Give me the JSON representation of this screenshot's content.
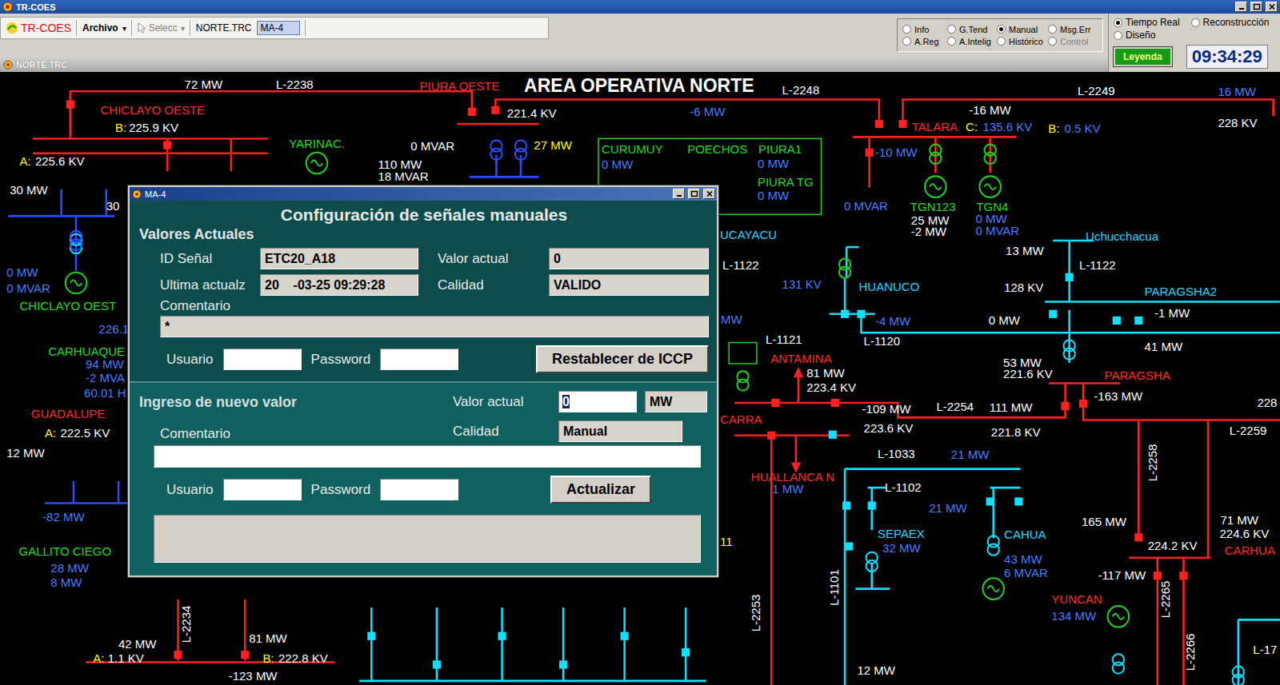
{
  "window": {
    "title": "TR-COES"
  },
  "toolbar": {
    "logo": "TR-COES",
    "menu": "Archivo",
    "menu_arrow": "▾",
    "select": "Selecc",
    "select_arrow": "▾",
    "file": "NORTE.TRC",
    "display": "MA-4"
  },
  "modes": [
    {
      "label": "Info",
      "selected": false,
      "disabled": false
    },
    {
      "label": "G.Tend",
      "selected": false,
      "disabled": false
    },
    {
      "label": "Manual",
      "selected": true,
      "disabled": false
    },
    {
      "label": "Msg.Err",
      "selected": false,
      "disabled": false
    },
    {
      "label": "A.Reg",
      "selected": false,
      "disabled": false
    },
    {
      "label": "A.Intelig",
      "selected": false,
      "disabled": false
    },
    {
      "label": "Histórico",
      "selected": false,
      "disabled": false
    },
    {
      "label": "Control",
      "selected": false,
      "disabled": true
    }
  ],
  "time_modes": [
    {
      "label": "Tiempo Real",
      "selected": true
    },
    {
      "label": "Reconstrucción",
      "selected": false
    },
    {
      "label": "Diseño",
      "selected": false
    }
  ],
  "legend_button": "Leyenda",
  "clock": "09:34:29",
  "subwindow": {
    "title": "NORTE.TRC"
  },
  "diagram": {
    "labels": [
      {
        "text": "72 MW",
        "color": "#ffffff",
        "kind": "label"
      },
      {
        "text": "L-2238",
        "color": "#ffffff",
        "kind": "label"
      },
      {
        "text": "PIURA OESTE",
        "color": "#ff2a2a",
        "kind": "label"
      },
      {
        "text": "AREA OPERATIVA NORTE",
        "color": "#ffffff",
        "kind": "title"
      },
      {
        "text": "L-2248",
        "color": "#ffffff",
        "kind": "label"
      },
      {
        "text": "L-2249",
        "color": "#ffffff",
        "kind": "label"
      },
      {
        "text": "16 MW",
        "color": "#4a7dff",
        "kind": "label"
      },
      {
        "text": "CHICLAYO OESTE",
        "color": "#ff2a2a",
        "kind": "label"
      },
      {
        "text": "B:",
        "color": "#ffff00",
        "kind": "label"
      },
      {
        "text": "225.9 KV",
        "color": "#ffffff",
        "kind": "label"
      },
      {
        "text": "221.4 KV",
        "color": "#ffffff",
        "kind": "label"
      },
      {
        "text": "-6 MW",
        "color": "#4a7dff",
        "kind": "label"
      },
      {
        "text": "-16 MW",
        "color": "#ffffff",
        "kind": "label"
      },
      {
        "text": "TALARA",
        "color": "#ff2a2a",
        "kind": "label"
      },
      {
        "text": "C:",
        "color": "#ffff00",
        "kind": "label"
      },
      {
        "text": "135.6 KV",
        "color": "#4a7dff",
        "kind": "label"
      },
      {
        "text": "B:",
        "color": "#ffff00",
        "kind": "label"
      },
      {
        "text": "0.5 KV",
        "color": "#4a7dff",
        "kind": "label"
      },
      {
        "text": "228 KV",
        "color": "#ffffff",
        "kind": "label"
      },
      {
        "text": "YARINAC.",
        "color": "#22dd22",
        "kind": "label"
      },
      {
        "text": "0 MVAR",
        "color": "#ffffff",
        "kind": "label"
      },
      {
        "text": "27 MW",
        "color": "#ffff00",
        "kind": "label"
      },
      {
        "text": "CURUMUY",
        "color": "#22dd22",
        "kind": "label"
      },
      {
        "text": "POECHOS",
        "color": "#22dd22",
        "kind": "label"
      },
      {
        "text": "PIURA1",
        "color": "#22dd22",
        "kind": "label"
      },
      {
        "text": "0 MW",
        "color": "#4a7dff",
        "kind": "label"
      },
      {
        "text": "0 MW",
        "color": "#4a7dff",
        "kind": "label"
      },
      {
        "text": "PIURA TG",
        "color": "#22dd22",
        "kind": "label"
      },
      {
        "text": "0 MW",
        "color": "#4a7dff",
        "kind": "label"
      },
      {
        "text": "-10 MW",
        "color": "#4a7dff",
        "kind": "label"
      },
      {
        "text": "A:",
        "color": "#ffff00",
        "kind": "label"
      },
      {
        "text": "225.6 KV",
        "color": "#ffffff",
        "kind": "label"
      },
      {
        "text": "110 MW",
        "color": "#ffffff",
        "kind": "label"
      },
      {
        "text": "18 MVAR",
        "color": "#ffffff",
        "kind": "label"
      },
      {
        "text": "30 MW",
        "color": "#ffffff",
        "kind": "label"
      },
      {
        "text": "0 MVAR",
        "color": "#4a7dff",
        "kind": "label"
      },
      {
        "text": "TGN123",
        "color": "#22dd22",
        "kind": "label"
      },
      {
        "text": "TGN4",
        "color": "#22dd22",
        "kind": "label"
      },
      {
        "text": "25 MW",
        "color": "#ffffff",
        "kind": "label"
      },
      {
        "text": "-2 MW",
        "color": "#ffffff",
        "kind": "label"
      },
      {
        "text": "0 MW",
        "color": "#4a7dff",
        "kind": "label"
      },
      {
        "text": "0 MVAR",
        "color": "#4a7dff",
        "kind": "label"
      },
      {
        "text": "30",
        "color": "#ffffff",
        "kind": "label"
      },
      {
        "text": "UCAYACU",
        "color": "#22d8ff",
        "kind": "label"
      },
      {
        "text": "Uchucchacua",
        "color": "#22d8ff",
        "kind": "label"
      },
      {
        "text": "13 MW",
        "color": "#ffffff",
        "kind": "label"
      },
      {
        "text": "L-1122",
        "color": "#ffffff",
        "kind": "label"
      },
      {
        "text": "L-1122",
        "color": "#ffffff",
        "kind": "label"
      },
      {
        "text": "0 MW",
        "color": "#4a7dff",
        "kind": "label"
      },
      {
        "text": "0 MVAR",
        "color": "#4a7dff",
        "kind": "label"
      },
      {
        "text": "131 KV",
        "color": "#4a7dff",
        "kind": "label"
      },
      {
        "text": "HUANUCO",
        "color": "#22d8ff",
        "kind": "label"
      },
      {
        "text": "128 KV",
        "color": "#ffffff",
        "kind": "label"
      },
      {
        "text": "PARAGSHA2",
        "color": "#22d8ff",
        "kind": "label"
      },
      {
        "text": "CHICLAYO OEST",
        "color": "#22dd22",
        "kind": "label"
      },
      {
        "text": "-4 MW",
        "color": "#4a7dff",
        "kind": "label"
      },
      {
        "text": "0 MW",
        "color": "#ffffff",
        "kind": "label"
      },
      {
        "text": "-1 MW",
        "color": "#ffffff",
        "kind": "label"
      },
      {
        "text": "MW",
        "color": "#4a7dff",
        "kind": "label"
      },
      {
        "text": "226.1",
        "color": "#4a7dff",
        "kind": "label"
      },
      {
        "text": "L-1121",
        "color": "#ffffff",
        "kind": "label"
      },
      {
        "text": "L-1120",
        "color": "#ffffff",
        "kind": "label"
      },
      {
        "text": "41 MW",
        "color": "#ffffff",
        "kind": "label"
      },
      {
        "text": "CARHUAQUE",
        "color": "#22dd22",
        "kind": "label"
      },
      {
        "text": "94 MW",
        "color": "#4a7dff",
        "kind": "label"
      },
      {
        "text": "-2 MVA",
        "color": "#4a7dff",
        "kind": "label"
      },
      {
        "text": "60.01 H",
        "color": "#4a7dff",
        "kind": "label"
      },
      {
        "text": "ANTAMINA",
        "color": "#ff2a2a",
        "kind": "label"
      },
      {
        "text": "81 MW",
        "color": "#ffffff",
        "kind": "label"
      },
      {
        "text": "223.4 KV",
        "color": "#ffffff",
        "kind": "label"
      },
      {
        "text": "53 MW",
        "color": "#ffffff",
        "kind": "label"
      },
      {
        "text": "221.6 KV",
        "color": "#ffffff",
        "kind": "label"
      },
      {
        "text": "PARAGSHA",
        "color": "#ff2a2a",
        "kind": "label"
      },
      {
        "text": "-163 MW",
        "color": "#ffffff",
        "kind": "label"
      },
      {
        "text": "GUADALUPE",
        "color": "#ff2a2a",
        "kind": "label"
      },
      {
        "text": "-109 MW",
        "color": "#ffffff",
        "kind": "label"
      },
      {
        "text": "L-2254",
        "color": "#ffffff",
        "kind": "label"
      },
      {
        "text": "111 MW",
        "color": "#ffffff",
        "kind": "label"
      },
      {
        "text": "228",
        "color": "#ffffff",
        "kind": "label"
      },
      {
        "text": "A:",
        "color": "#ffff00",
        "kind": "label"
      },
      {
        "text": "222.5 KV",
        "color": "#ffffff",
        "kind": "label"
      },
      {
        "text": "CARRA",
        "color": "#ff2a2a",
        "kind": "label"
      },
      {
        "text": "223.6 KV",
        "color": "#ffffff",
        "kind": "label"
      },
      {
        "text": "221.8 KV",
        "color": "#ffffff",
        "kind": "label"
      },
      {
        "text": "L-2259",
        "color": "#ffffff",
        "kind": "label"
      },
      {
        "text": "12 MW",
        "color": "#ffffff",
        "kind": "label"
      },
      {
        "text": "L-1033",
        "color": "#ffffff",
        "kind": "label"
      },
      {
        "text": "21 MW",
        "color": "#4a7dff",
        "kind": "label"
      },
      {
        "text": "HUALLANCA N",
        "color": "#ff2a2a",
        "kind": "label"
      },
      {
        "text": "1 MW",
        "color": "#4a7dff",
        "kind": "label"
      },
      {
        "text": "L-1102",
        "color": "#ffffff",
        "kind": "label"
      },
      {
        "text": "L-2258",
        "color": "#ffffff",
        "kind": "vertical"
      },
      {
        "text": "21 MW",
        "color": "#4a7dff",
        "kind": "label"
      },
      {
        "text": "-82 MW",
        "color": "#4a7dff",
        "kind": "label"
      },
      {
        "text": "SEPAEX",
        "color": "#22d8ff",
        "kind": "label"
      },
      {
        "text": "32 MW",
        "color": "#4a7dff",
        "kind": "label"
      },
      {
        "text": "CAHUA",
        "color": "#22d8ff",
        "kind": "label"
      },
      {
        "text": "43 MW",
        "color": "#4a7dff",
        "kind": "label"
      },
      {
        "text": "6 MVAR",
        "color": "#4a7dff",
        "kind": "label"
      },
      {
        "text": "165 MW",
        "color": "#ffffff",
        "kind": "label"
      },
      {
        "text": "71 MW",
        "color": "#ffffff",
        "kind": "label"
      },
      {
        "text": "224.2 KV",
        "color": "#ffffff",
        "kind": "label"
      },
      {
        "text": "224.6 KV",
        "color": "#ffffff",
        "kind": "label"
      },
      {
        "text": "CARHUA",
        "color": "#ff2a2a",
        "kind": "label"
      },
      {
        "text": "GALLITO CIEGO",
        "color": "#22dd22",
        "kind": "label"
      },
      {
        "text": "28 MW",
        "color": "#4a7dff",
        "kind": "label"
      },
      {
        "text": "8 MW",
        "color": "#4a7dff",
        "kind": "label"
      },
      {
        "text": "-117 MW",
        "color": "#ffffff",
        "kind": "label"
      },
      {
        "text": "YUNCAN",
        "color": "#ff2a2a",
        "kind": "label"
      },
      {
        "text": "134 MW",
        "color": "#4a7dff",
        "kind": "label"
      },
      {
        "text": "L-1101",
        "color": "#ffffff",
        "kind": "vertical"
      },
      {
        "text": "L-2253",
        "color": "#ffffff",
        "kind": "vertical"
      },
      {
        "text": "L-2265",
        "color": "#ffffff",
        "kind": "vertical"
      },
      {
        "text": "L-2266",
        "color": "#ffffff",
        "kind": "vertical"
      },
      {
        "text": "L-2234",
        "color": "#ffffff",
        "kind": "vertical"
      },
      {
        "text": "L-17",
        "color": "#ffffff",
        "kind": "label"
      },
      {
        "text": "42 MW",
        "color": "#ffffff",
        "kind": "label"
      },
      {
        "text": "81 MW",
        "color": "#ffffff",
        "kind": "label"
      },
      {
        "text": "A:",
        "color": "#ffff00",
        "kind": "label"
      },
      {
        "text": "1.1 KV",
        "color": "#ffffff",
        "kind": "label"
      },
      {
        "text": "B:",
        "color": "#ffff00",
        "kind": "label"
      },
      {
        "text": "222.8 KV",
        "color": "#ffffff",
        "kind": "label"
      },
      {
        "text": "-123 MW",
        "color": "#ffffff",
        "kind": "label"
      },
      {
        "text": "12 MW",
        "color": "#ffffff",
        "kind": "label"
      },
      {
        "text": "11",
        "color": "#ffff00",
        "kind": "label"
      }
    ]
  },
  "dialog": {
    "title": "MA-4",
    "heading": "Configuración de señales manuales",
    "current": {
      "section": "Valores  Actuales",
      "id_label": "ID Señal",
      "id_value": "ETC20_A18",
      "value_label": "Valor actual",
      "value": "0",
      "updated_label": "Ultima actualz",
      "updated": "20    -03-25 09:29:28",
      "quality_label": "Calidad",
      "quality": "VALIDO",
      "comment_label": "Comentario",
      "comment": "*",
      "user_label": "Usuario",
      "user": "",
      "password_label": "Password",
      "password": "",
      "button": "Restablecer de ICCP"
    },
    "new": {
      "section": "Ingreso de nuevo valor",
      "value_label": "Valor actual",
      "value": "0",
      "value_selected": true,
      "unit": "MW",
      "quality_label": "Calidad",
      "quality": "Manual",
      "comment_label": "Comentario",
      "comment": "",
      "user_label": "Usuario",
      "user": "",
      "password_label": "Password",
      "password": "",
      "button": "Actualizar",
      "message": ""
    }
  }
}
